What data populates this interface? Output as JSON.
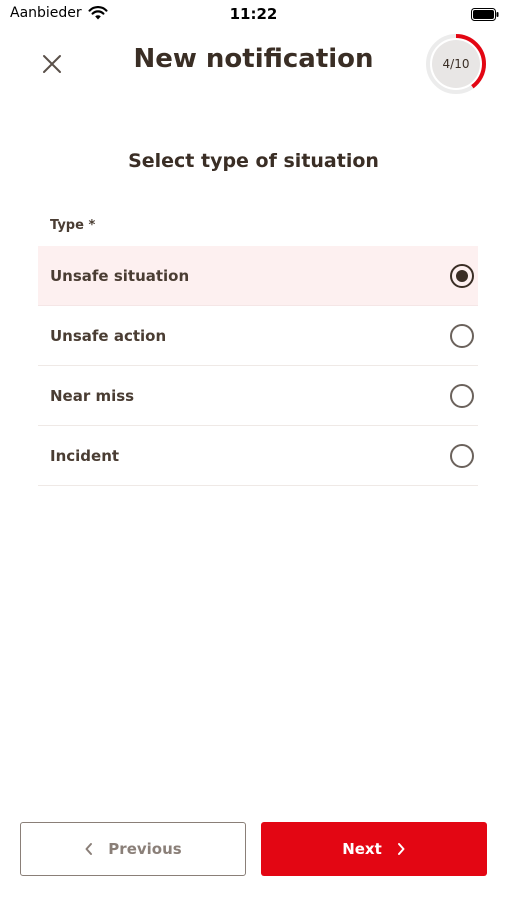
{
  "status_bar": {
    "carrier": "Aanbieder",
    "time": "11:22"
  },
  "header": {
    "title": "New notification",
    "progress_text": "4/10",
    "progress_fraction": 0.4
  },
  "form": {
    "section_title": "Select type of situation",
    "field_label": "Type *",
    "options": [
      {
        "label": "Unsafe situation",
        "selected": true
      },
      {
        "label": "Unsafe action",
        "selected": false
      },
      {
        "label": "Near miss",
        "selected": false
      },
      {
        "label": "Incident",
        "selected": false
      }
    ]
  },
  "footer": {
    "previous_label": "Previous",
    "next_label": "Next"
  },
  "colors": {
    "accent": "#e30613",
    "text": "#3a2e25",
    "selected_bg": "#fdf0f0"
  },
  "icons": {
    "close": "close-icon",
    "wifi": "wifi-icon",
    "battery": "battery-icon",
    "prev": "chevron-left-icon",
    "next": "chevron-right-icon"
  }
}
